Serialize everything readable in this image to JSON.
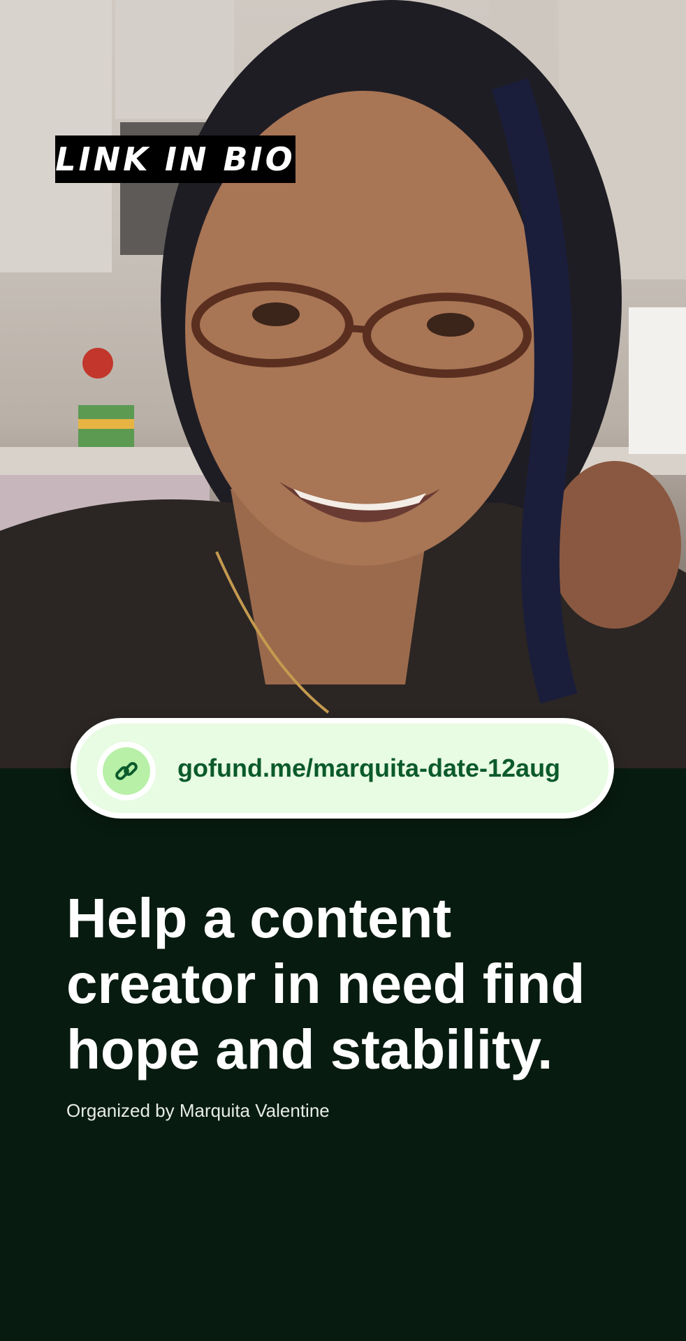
{
  "overlay": {
    "bio_tag": "LINK IN BIO"
  },
  "link": {
    "icon": "link-icon",
    "url": "gofund.me/marquita-date-12aug"
  },
  "campaign": {
    "headline": "Help a content creator in need find hope and stability.",
    "organizer": "Organized by Marquita Valentine"
  },
  "colors": {
    "background": "#081b10",
    "link_text": "#0b5a2c",
    "link_pill": "#e8fbe3",
    "link_icon_disc": "#b8f0a8"
  }
}
